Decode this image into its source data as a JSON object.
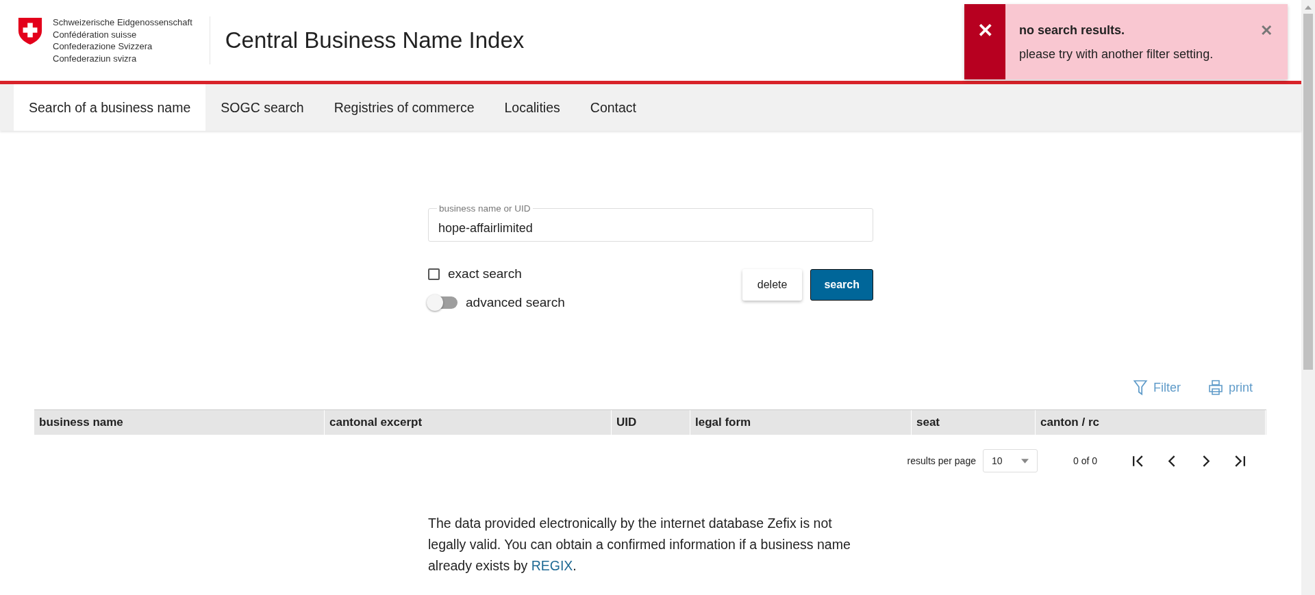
{
  "header": {
    "confederation_lines": [
      "Schweizerische Eidgenossenschaft",
      "Confédération suisse",
      "Confederazione Svizzera",
      "Confederaziun svizra"
    ],
    "title": "Central Business Name Index"
  },
  "toast": {
    "icon": "✕",
    "title": "no search results.",
    "message": "please try with another filter setting.",
    "close": "✕"
  },
  "tabs": [
    {
      "label": "Search of a business name",
      "selected": true
    },
    {
      "label": "SOGC search",
      "selected": false
    },
    {
      "label": "Registries of commerce",
      "selected": false
    },
    {
      "label": "Localities",
      "selected": false
    },
    {
      "label": "Contact",
      "selected": false
    }
  ],
  "search": {
    "label": "business name or UID",
    "value": "hope-affairlimited",
    "exact_search": {
      "label": "exact search",
      "checked": false
    },
    "advanced_search": {
      "label": "advanced search",
      "on": false
    },
    "buttons": [
      {
        "label": "delete",
        "kind": "secondary"
      },
      {
        "label": "search",
        "kind": "primary"
      }
    ]
  },
  "table_tools": [
    {
      "label": "Filter",
      "kind": "filter"
    },
    {
      "label": "print",
      "kind": "print"
    }
  ],
  "table": {
    "columns": [
      "business name",
      "cantonal excerpt",
      "UID",
      "legal form",
      "seat",
      "canton / rc"
    ]
  },
  "pagination": {
    "per_page_label": "results per page",
    "per_page": "10",
    "range": "0 of 0"
  },
  "notice": {
    "before": "The data provided electronically by the internet database Zefix is not legally valid. You can obtain a confirmed information if a business name already exists by ",
    "link": "REGIX",
    "after": "."
  }
}
